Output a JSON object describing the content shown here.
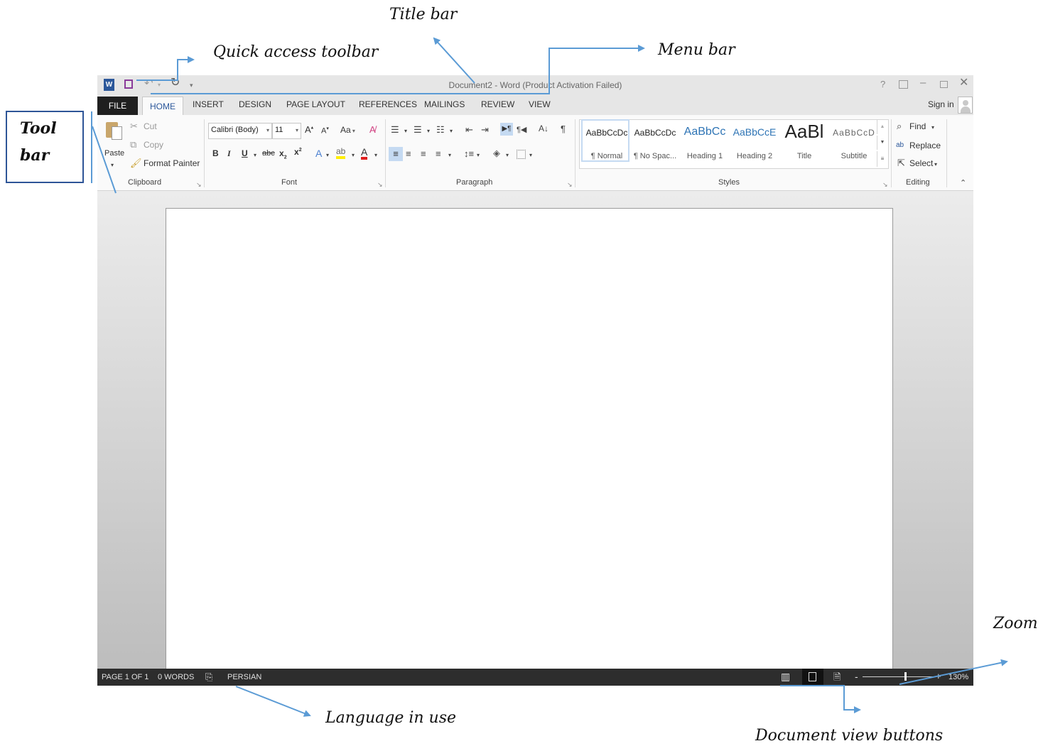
{
  "annotations": {
    "title_bar": "Title bar",
    "quick_access": "Quick access toolbar",
    "menu_bar": "Menu bar",
    "tool_bar_line1": "Tool",
    "tool_bar_line2": "bar",
    "zoom": "Zoom",
    "language": "Language in use",
    "view_buttons": "Document view buttons"
  },
  "window": {
    "title": "Document2 - Word (Product Activation Failed)",
    "sign_in": "Sign in",
    "qat_more": "▾"
  },
  "menu": {
    "tabs": [
      "FILE",
      "HOME",
      "INSERT",
      "DESIGN",
      "PAGE LAYOUT",
      "REFERENCES",
      "MAILINGS",
      "REVIEW",
      "VIEW"
    ],
    "active": "HOME"
  },
  "ribbon": {
    "clipboard": {
      "label": "Clipboard",
      "paste": "Paste",
      "cut": "Cut",
      "copy": "Copy",
      "format_painter": "Format Painter"
    },
    "font": {
      "label": "Font",
      "font_name": "Calibri (Body)",
      "font_size": "11",
      "change_case": "Aa"
    },
    "paragraph": {
      "label": "Paragraph"
    },
    "styles": {
      "label": "Styles",
      "items": [
        {
          "preview": "AaBbCcDc",
          "name": "¶ Normal"
        },
        {
          "preview": "AaBbCcDc",
          "name": "¶ No Spac..."
        },
        {
          "preview": "AaBbCc",
          "name": "Heading 1"
        },
        {
          "preview": "AaBbCcE",
          "name": "Heading 2"
        },
        {
          "preview": "AaBl",
          "name": "Title"
        },
        {
          "preview": "AaBbCcD",
          "name": "Subtitle"
        }
      ]
    },
    "editing": {
      "label": "Editing",
      "find": "Find",
      "replace": "Replace",
      "select": "Select"
    }
  },
  "status": {
    "page": "PAGE 1 OF 1",
    "words": "0 WORDS",
    "language": "PERSIAN",
    "zoom": "130%",
    "zoom_level": 0.6
  },
  "colors": {
    "accent": "#2b579a",
    "callout_arrow": "#5b9bd5",
    "status_bg": "#2d2d2d"
  }
}
